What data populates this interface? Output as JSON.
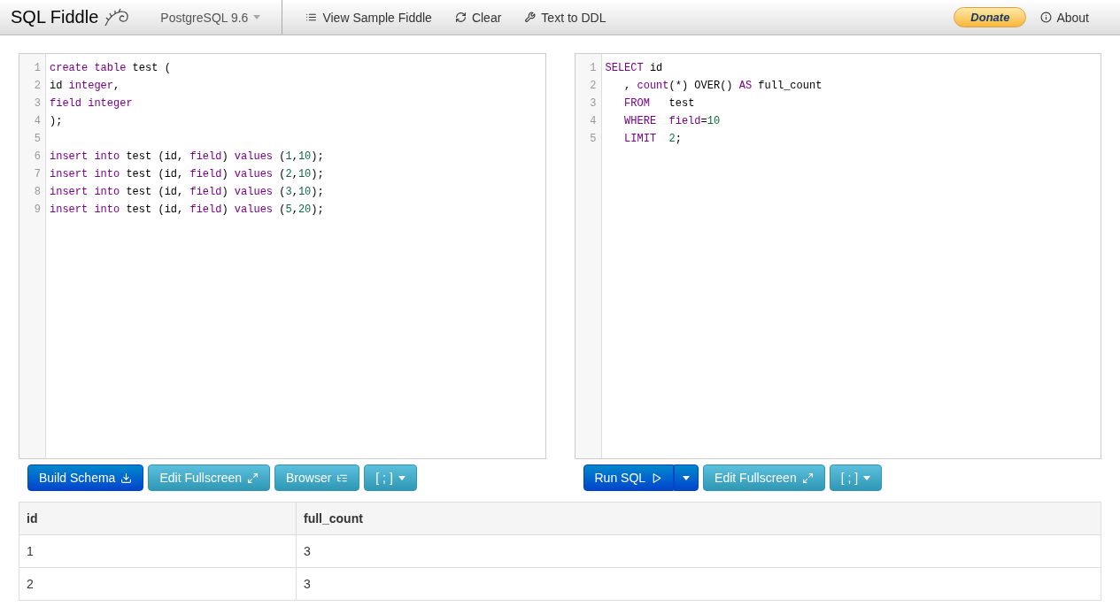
{
  "navbar": {
    "brand": "SQL Fiddle",
    "database": "PostgreSQL 9.6",
    "links": [
      {
        "label": "View Sample Fiddle"
      },
      {
        "label": "Clear"
      },
      {
        "label": "Text to DDL"
      }
    ],
    "donate": "Donate",
    "about": "About"
  },
  "schema_editor": {
    "lines": [
      {
        "number": "1",
        "tokens": [
          {
            "text": "create table",
            "kind": "keyword"
          },
          {
            "text": " test (",
            "kind": "plain"
          }
        ]
      },
      {
        "number": "2",
        "tokens": [
          {
            "text": "id ",
            "kind": "plain"
          },
          {
            "text": "integer",
            "kind": "keyword"
          },
          {
            "text": ",",
            "kind": "plain"
          }
        ]
      },
      {
        "number": "3",
        "tokens": [
          {
            "text": "field integer",
            "kind": "keyword"
          }
        ]
      },
      {
        "number": "4",
        "tokens": [
          {
            "text": ");",
            "kind": "plain"
          }
        ]
      },
      {
        "number": "5"
      },
      {
        "number": "6",
        "tokens": [
          {
            "text": "insert into",
            "kind": "keyword"
          },
          {
            "text": " test (id, ",
            "kind": "plain"
          },
          {
            "text": "field",
            "kind": "keyword"
          },
          {
            "text": ") ",
            "kind": "plain"
          },
          {
            "text": "values",
            "kind": "keyword"
          },
          {
            "text": " (",
            "kind": "plain"
          },
          {
            "text": "1",
            "kind": "number"
          },
          {
            "text": ",",
            "kind": "plain"
          },
          {
            "text": "10",
            "kind": "number"
          },
          {
            "text": ");",
            "kind": "plain"
          }
        ]
      },
      {
        "number": "7",
        "tokens": [
          {
            "text": "insert into",
            "kind": "keyword"
          },
          {
            "text": " test (id, ",
            "kind": "plain"
          },
          {
            "text": "field",
            "kind": "keyword"
          },
          {
            "text": ") ",
            "kind": "plain"
          },
          {
            "text": "values",
            "kind": "keyword"
          },
          {
            "text": " (",
            "kind": "plain"
          },
          {
            "text": "2",
            "kind": "number"
          },
          {
            "text": ",",
            "kind": "plain"
          },
          {
            "text": "10",
            "kind": "number"
          },
          {
            "text": ");",
            "kind": "plain"
          }
        ]
      },
      {
        "number": "8",
        "tokens": [
          {
            "text": "insert into",
            "kind": "keyword"
          },
          {
            "text": " test (id, ",
            "kind": "plain"
          },
          {
            "text": "field",
            "kind": "keyword"
          },
          {
            "text": ") ",
            "kind": "plain"
          },
          {
            "text": "values",
            "kind": "keyword"
          },
          {
            "text": " (",
            "kind": "plain"
          },
          {
            "text": "3",
            "kind": "number"
          },
          {
            "text": ",",
            "kind": "plain"
          },
          {
            "text": "10",
            "kind": "number"
          },
          {
            "text": ");",
            "kind": "plain"
          }
        ]
      },
      {
        "number": "9",
        "tokens": [
          {
            "text": "insert into",
            "kind": "keyword"
          },
          {
            "text": " test (id, ",
            "kind": "plain"
          },
          {
            "text": "field",
            "kind": "keyword"
          },
          {
            "text": ") ",
            "kind": "plain"
          },
          {
            "text": "values",
            "kind": "keyword"
          },
          {
            "text": " (",
            "kind": "plain"
          },
          {
            "text": "5",
            "kind": "number"
          },
          {
            "text": ",",
            "kind": "plain"
          },
          {
            "text": "20",
            "kind": "number"
          },
          {
            "text": ");",
            "kind": "plain"
          }
        ]
      }
    ],
    "buttons": [
      {
        "label": "Build Schema",
        "kind": "primary"
      },
      {
        "label": "Edit Fullscreen",
        "kind": "info"
      },
      {
        "label": "Browser",
        "kind": "info"
      },
      {
        "label": "[ ; ]",
        "kind": "info"
      }
    ]
  },
  "query_editor": {
    "lines": [
      {
        "number": "1",
        "tokens": [
          {
            "text": "SELECT",
            "kind": "keyword"
          },
          {
            "text": " id",
            "kind": "plain"
          }
        ]
      },
      {
        "number": "2",
        "tokens": [
          {
            "text": "   , ",
            "kind": "plain"
          },
          {
            "text": "count",
            "kind": "keyword"
          },
          {
            "text": "(*) OVER() ",
            "kind": "plain"
          },
          {
            "text": "AS",
            "kind": "keyword"
          },
          {
            "text": " full_count",
            "kind": "plain"
          }
        ]
      },
      {
        "number": "3",
        "tokens": [
          {
            "text": "   FROM",
            "kind": "keyword"
          },
          {
            "text": "   test",
            "kind": "plain"
          }
        ]
      },
      {
        "number": "4",
        "tokens": [
          {
            "text": "   WHERE  field",
            "kind": "keyword"
          },
          {
            "text": "=",
            "kind": "plain"
          },
          {
            "text": "10",
            "kind": "number"
          }
        ]
      },
      {
        "number": "5",
        "tokens": [
          {
            "text": "   LIMIT",
            "kind": "keyword"
          },
          {
            "text": "  2",
            "kind": "number"
          },
          {
            "text": ";",
            "kind": "plain"
          }
        ]
      }
    ],
    "buttons": [
      {
        "label": "Run SQL",
        "kind": "primary"
      },
      {
        "kind": "split"
      },
      {
        "label": "Edit Fullscreen",
        "kind": "info"
      },
      {
        "label": "[ ; ]",
        "kind": "info"
      }
    ]
  },
  "results": {
    "columns": [
      "id",
      "full_count"
    ],
    "rows": [
      [
        "1",
        "3"
      ],
      [
        "2",
        "3"
      ]
    ]
  }
}
